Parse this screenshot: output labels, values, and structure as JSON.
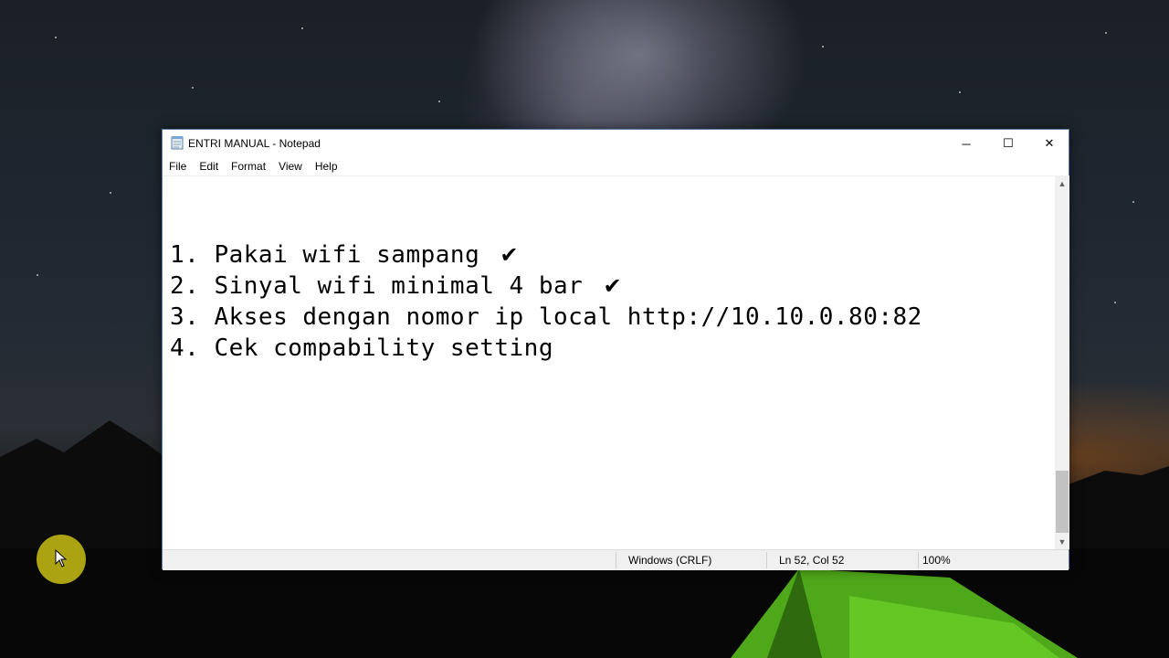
{
  "window": {
    "title": "ENTRI MANUAL - Notepad",
    "controls": {
      "minimize": "─",
      "maximize": "☐",
      "close": "✕"
    }
  },
  "menu": [
    "File",
    "Edit",
    "Format",
    "View",
    "Help"
  ],
  "document": {
    "lines": [
      {
        "text": "1. Pakai wifi sampang",
        "check": "✔"
      },
      {
        "text": "2. Sinyal wifi minimal 4 bar",
        "check": "✔"
      },
      {
        "text": "3. Akses dengan nomor ip local http://10.10.0.80:82",
        "check": ""
      },
      {
        "text": "4. Cek compability setting",
        "check": ""
      }
    ]
  },
  "statusbar": {
    "line_ending": "Windows (CRLF)",
    "position": "Ln 52, Col 52",
    "zoom": "100%"
  },
  "icons": {
    "scroll_up": "▲",
    "scroll_down": "▼"
  },
  "colors": {
    "window_border": "#5c7ea6",
    "cursor_highlight": "#c8be14"
  }
}
